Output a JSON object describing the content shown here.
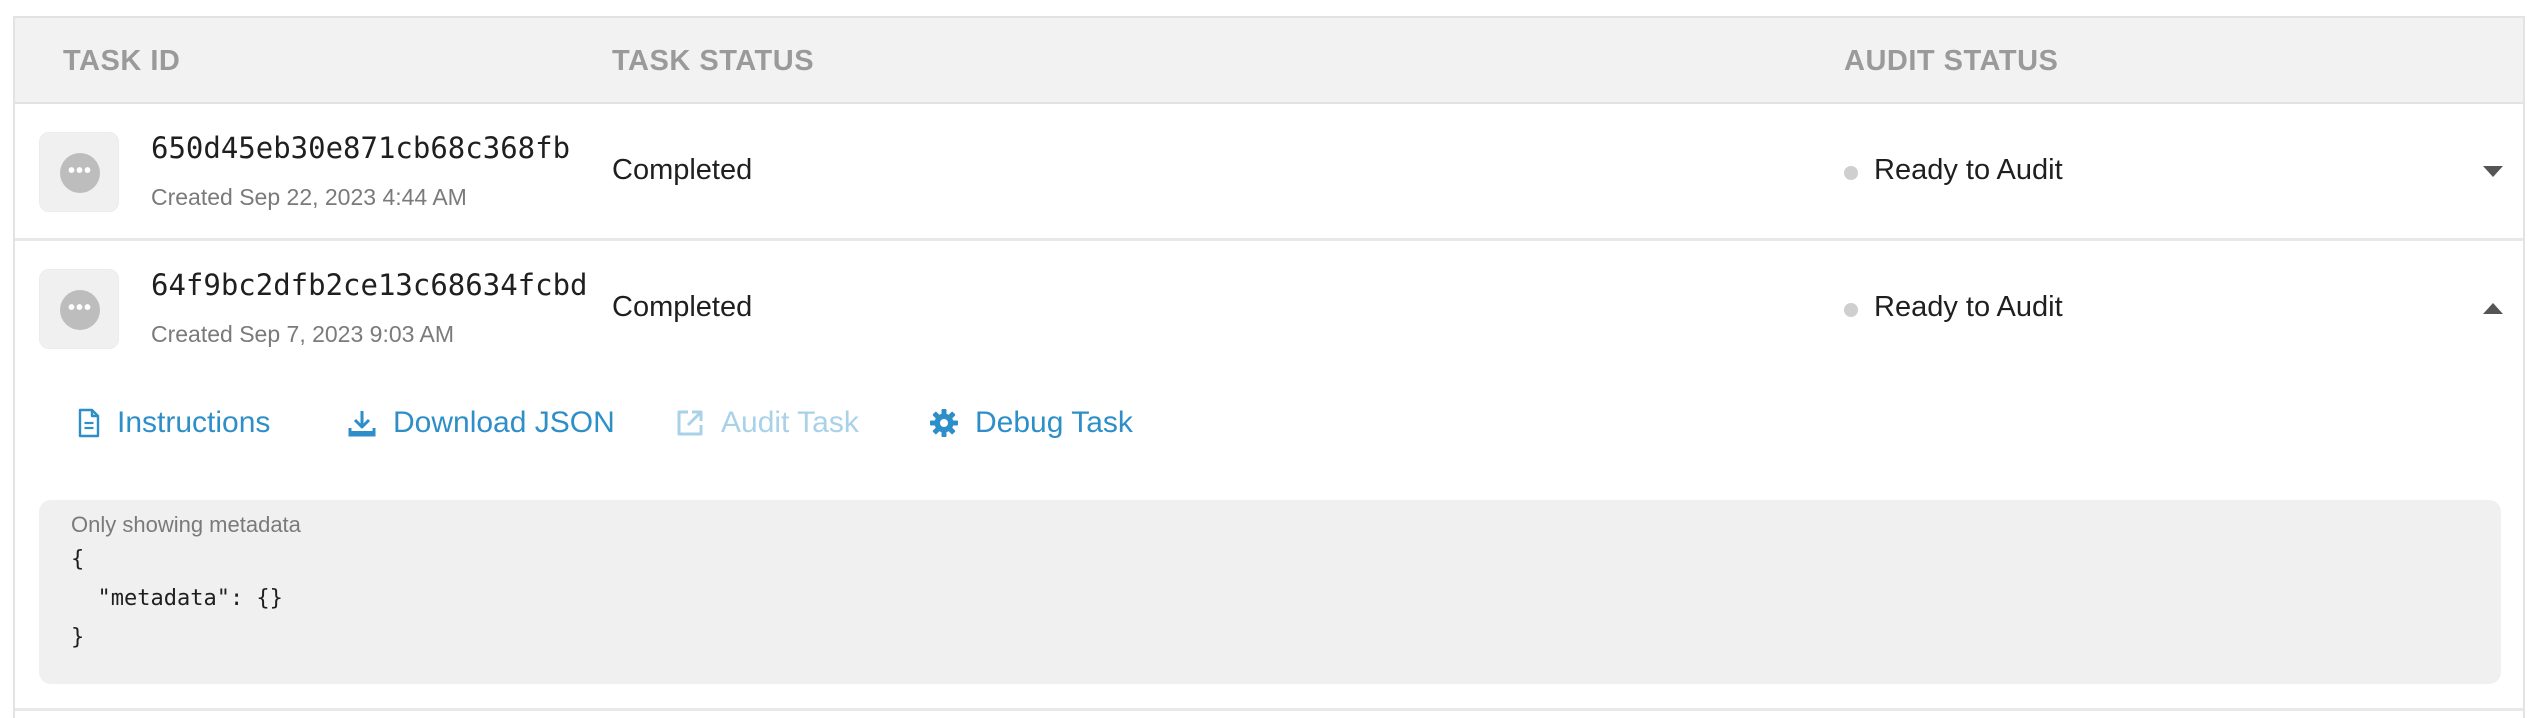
{
  "header": {
    "col_task_id": "TASK ID",
    "col_task_status": "TASK STATUS",
    "col_audit_status": "AUDIT STATUS"
  },
  "rows": [
    {
      "task_id": "650d45eb30e871cb68c368fb",
      "created": "Created Sep 22, 2023 4:44 AM",
      "task_status": "Completed",
      "audit_status": "Ready to Audit",
      "expanded": false
    },
    {
      "task_id": "64f9bc2dfb2ce13c68634fcbd",
      "created": "Created Sep 7, 2023 9:03 AM",
      "task_status": "Completed",
      "audit_status": "Ready to Audit",
      "expanded": true
    }
  ],
  "actions": {
    "instructions": "Instructions",
    "download_json": "Download JSON",
    "audit_task": "Audit Task",
    "debug_task": "Debug Task"
  },
  "metadata_panel": {
    "note": "Only showing metadata",
    "code": "{\n  \"metadata\": {}\n}"
  },
  "colors": {
    "link": "#2e8fc8",
    "link_disabled": "#a9d1e8",
    "status_dot": "#cfcfcf",
    "header_bg": "#f2f2f2"
  },
  "icons": {
    "avatar": "more-horizontal-icon",
    "collapsed": "caret-down-icon",
    "expanded": "caret-up-icon",
    "instructions": "document-icon",
    "download": "download-icon",
    "audit": "external-link-icon",
    "debug": "gear-icon"
  }
}
